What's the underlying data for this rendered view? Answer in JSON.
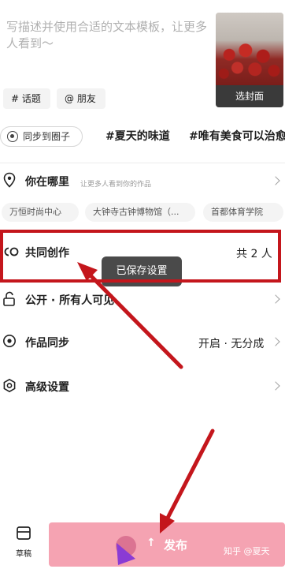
{
  "description": {
    "placeholder": "写描述并使用合适的文本模板，让更多人看到～"
  },
  "cover": {
    "label": "选封面"
  },
  "chips": {
    "topic": "# 话题",
    "friend": "@ 朋友"
  },
  "tags": {
    "sync_label": "同步到圈子",
    "tag_1": "#夏天的味道",
    "tag_2": "#唯有美食可以治愈"
  },
  "location": {
    "title": "你在哪里",
    "subtitle": "让更多人看到你的作品",
    "suggestions": [
      "万恒时尚中心",
      "大钟寺古钟博物馆（...",
      "首都体育学院"
    ]
  },
  "co_create": {
    "title": "共同创作",
    "value": "共 2 人"
  },
  "visibility": {
    "title": "公开 · 所有人可见"
  },
  "sync": {
    "title": "作品同步",
    "value": "开启 · 无分成"
  },
  "advanced": {
    "title": "高级设置"
  },
  "toast": {
    "text": "已保存设置"
  },
  "bottom": {
    "drafts_label": "草稿",
    "publish_label": "发布",
    "watermark": "知乎 @夏天"
  },
  "colors": {
    "publish_bg": "#f5a3b2",
    "annotation_red": "#c4161c",
    "toast_bg": "#4a4a4a"
  },
  "icons": {
    "location": "location-pin-icon",
    "co_create": "co-create-icon",
    "visibility": "unlock-icon",
    "sync": "sync-circle-icon",
    "advanced": "settings-hexagon-icon",
    "drafts": "drafts-box-icon",
    "chevron": "chevron-right-icon"
  }
}
